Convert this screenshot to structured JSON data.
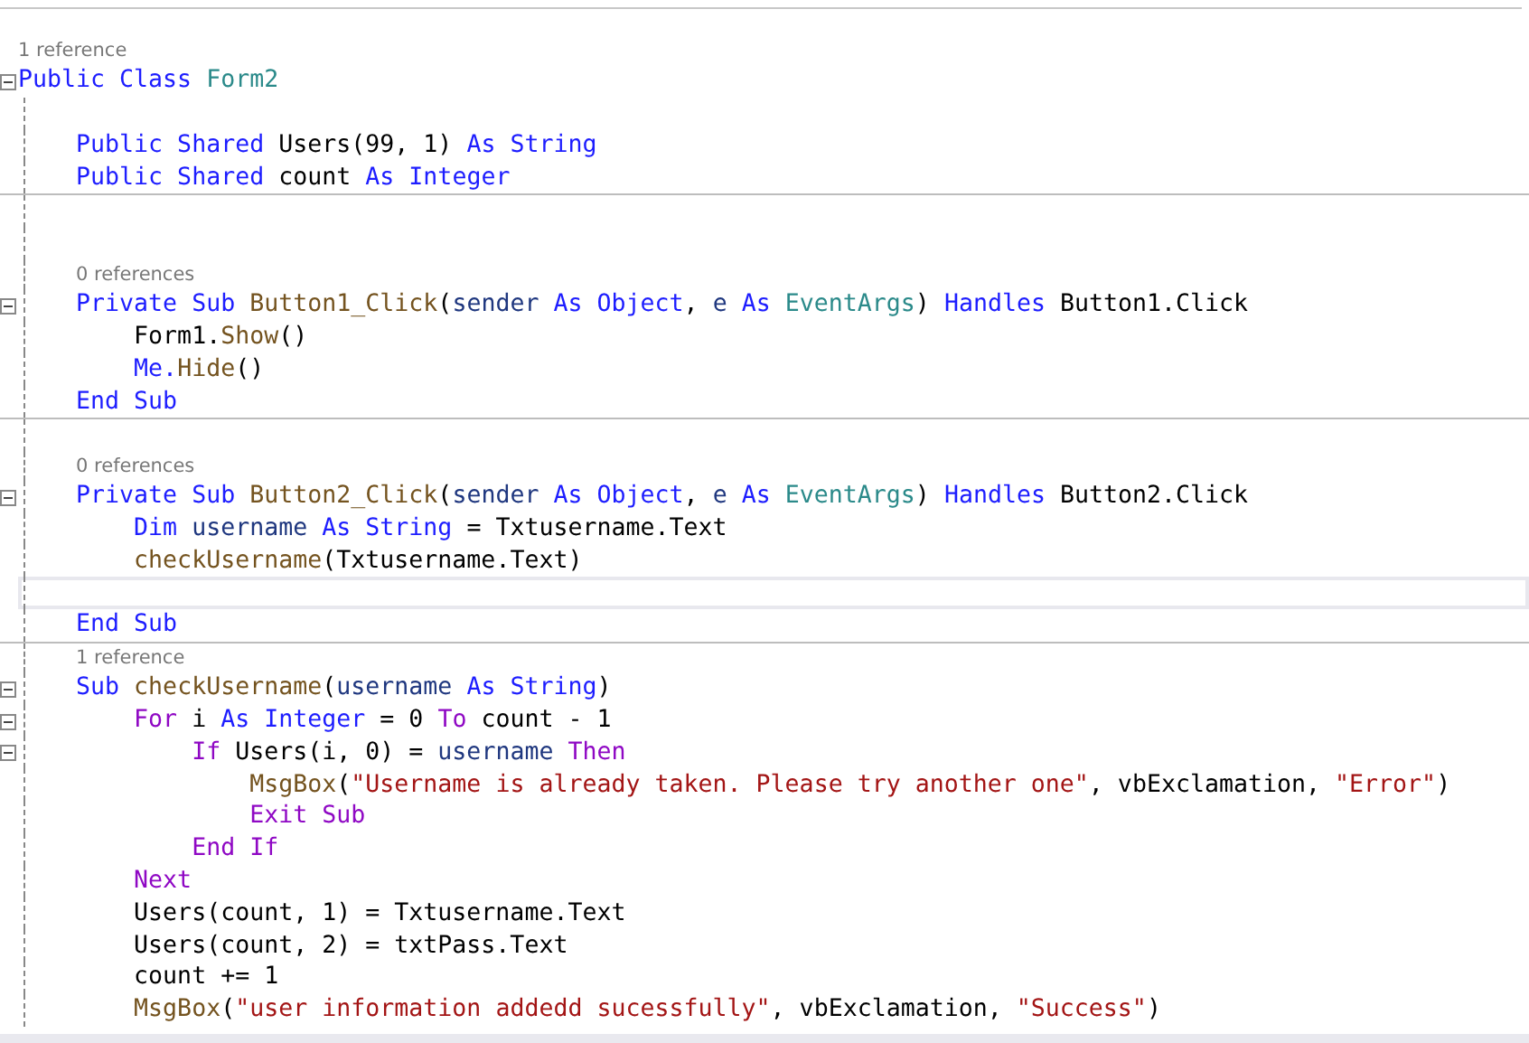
{
  "editor": {
    "lines": [
      {
        "kind": "code",
        "codelens": "1 reference",
        "expanded": true,
        "tokens": [
          {
            "text": "Public Class ",
            "kind": "kw"
          },
          {
            "text": "Form2",
            "kind": "type"
          }
        ]
      },
      {
        "kind": "blank"
      },
      {
        "kind": "code",
        "tokens": [
          {
            "text": "    Public Shared ",
            "kind": "kw"
          },
          {
            "text": "Users(99, 1) ",
            "kind": "plain"
          },
          {
            "text": "As String",
            "kind": "kw"
          }
        ]
      },
      {
        "kind": "code",
        "divider": true,
        "tokens": [
          {
            "text": "    Public Shared ",
            "kind": "kw"
          },
          {
            "text": "count ",
            "kind": "plain"
          },
          {
            "text": "As Integer",
            "kind": "kw"
          }
        ]
      },
      {
        "kind": "blank"
      },
      {
        "kind": "blank"
      },
      {
        "kind": "code",
        "codelens": "0 references",
        "expanded": true,
        "tokens": [
          {
            "text": "    Private Sub ",
            "kind": "kw"
          },
          {
            "text": "Button1_Click",
            "kind": "method"
          },
          {
            "text": "(",
            "kind": "plain"
          },
          {
            "text": "sender",
            "kind": "param"
          },
          {
            "text": " As Object",
            "kind": "kw"
          },
          {
            "text": ", ",
            "kind": "plain"
          },
          {
            "text": "e",
            "kind": "param"
          },
          {
            "text": " As ",
            "kind": "kw"
          },
          {
            "text": "EventArgs",
            "kind": "type"
          },
          {
            "text": ") ",
            "kind": "plain"
          },
          {
            "text": "Handles ",
            "kind": "kw"
          },
          {
            "text": "Button1.Click",
            "kind": "plain"
          }
        ]
      },
      {
        "kind": "code",
        "tokens": [
          {
            "text": "        Form1.",
            "kind": "plain"
          },
          {
            "text": "Show",
            "kind": "method"
          },
          {
            "text": "()",
            "kind": "plain"
          }
        ]
      },
      {
        "kind": "code",
        "tokens": [
          {
            "text": "        Me.",
            "kind": "kw"
          },
          {
            "text": "Hide",
            "kind": "method"
          },
          {
            "text": "()",
            "kind": "plain"
          }
        ]
      },
      {
        "kind": "code",
        "divider": true,
        "tokens": [
          {
            "text": "    End Sub",
            "kind": "kw"
          }
        ]
      },
      {
        "kind": "blank"
      },
      {
        "kind": "code",
        "codelens": "0 references",
        "expanded": true,
        "tokens": [
          {
            "text": "    Private Sub ",
            "kind": "kw"
          },
          {
            "text": "Button2_Click",
            "kind": "method"
          },
          {
            "text": "(",
            "kind": "plain"
          },
          {
            "text": "sender",
            "kind": "param"
          },
          {
            "text": " As Object",
            "kind": "kw"
          },
          {
            "text": ", ",
            "kind": "plain"
          },
          {
            "text": "e",
            "kind": "param"
          },
          {
            "text": " As ",
            "kind": "kw"
          },
          {
            "text": "EventArgs",
            "kind": "type"
          },
          {
            "text": ") ",
            "kind": "plain"
          },
          {
            "text": "Handles ",
            "kind": "kw"
          },
          {
            "text": "Button2.Click",
            "kind": "plain"
          }
        ]
      },
      {
        "kind": "code",
        "tokens": [
          {
            "text": "        Dim ",
            "kind": "kw"
          },
          {
            "text": "username",
            "kind": "param"
          },
          {
            "text": " As String",
            "kind": "kw"
          },
          {
            "text": " = Txtusername.Text",
            "kind": "plain"
          }
        ]
      },
      {
        "kind": "code",
        "tokens": [
          {
            "text": "        checkUsername",
            "kind": "method"
          },
          {
            "text": "(Txtusername.Text)",
            "kind": "plain"
          }
        ]
      },
      {
        "kind": "blank",
        "current": true
      },
      {
        "kind": "code",
        "divider": true,
        "tokens": [
          {
            "text": "    End Sub",
            "kind": "kw"
          }
        ]
      },
      {
        "kind": "code",
        "codelens": "1 reference",
        "expanded": true,
        "tokens": [
          {
            "text": "    Sub ",
            "kind": "kw"
          },
          {
            "text": "checkUsername",
            "kind": "method"
          },
          {
            "text": "(",
            "kind": "plain"
          },
          {
            "text": "username",
            "kind": "param"
          },
          {
            "text": " As String",
            "kind": "kw"
          },
          {
            "text": ")",
            "kind": "plain"
          }
        ]
      },
      {
        "kind": "code",
        "expanded": true,
        "tokens": [
          {
            "text": "        For ",
            "kind": "ctrl"
          },
          {
            "text": "i ",
            "kind": "plain"
          },
          {
            "text": "As Integer",
            "kind": "kw"
          },
          {
            "text": " = 0 ",
            "kind": "plain"
          },
          {
            "text": "To ",
            "kind": "ctrl"
          },
          {
            "text": "count - 1",
            "kind": "plain"
          }
        ]
      },
      {
        "kind": "code",
        "expanded": true,
        "tokens": [
          {
            "text": "            If ",
            "kind": "ctrl"
          },
          {
            "text": "Users(i, 0) = ",
            "kind": "plain"
          },
          {
            "text": "username",
            "kind": "param"
          },
          {
            "text": " Then",
            "kind": "ctrl"
          }
        ]
      },
      {
        "kind": "code",
        "tokens": [
          {
            "text": "                MsgBox",
            "kind": "method"
          },
          {
            "text": "(",
            "kind": "plain"
          },
          {
            "text": "\"Username is already taken. Please try another one\"",
            "kind": "str"
          },
          {
            "text": ", vbExclamation, ",
            "kind": "plain"
          },
          {
            "text": "\"Error\"",
            "kind": "str"
          },
          {
            "text": ")",
            "kind": "plain"
          }
        ]
      },
      {
        "kind": "code",
        "tokens": [
          {
            "text": "                Exit Sub",
            "kind": "ctrl"
          }
        ]
      },
      {
        "kind": "code",
        "tokens": [
          {
            "text": "            End If",
            "kind": "ctrl"
          }
        ]
      },
      {
        "kind": "code",
        "tokens": [
          {
            "text": "        Next",
            "kind": "ctrl"
          }
        ]
      },
      {
        "kind": "code",
        "tokens": [
          {
            "text": "        Users(count, 1) = Txtusername.Text",
            "kind": "plain"
          }
        ]
      },
      {
        "kind": "code",
        "tokens": [
          {
            "text": "        Users(count, 2) = txtPass.Text",
            "kind": "plain"
          }
        ]
      },
      {
        "kind": "code",
        "tokens": [
          {
            "text": "        count += 1",
            "kind": "plain"
          }
        ]
      },
      {
        "kind": "code",
        "tokens": [
          {
            "text": "        MsgBox",
            "kind": "method"
          },
          {
            "text": "(",
            "kind": "plain"
          },
          {
            "text": "\"user information addedd sucessfully\"",
            "kind": "str"
          },
          {
            "text": ", vbExclamation, ",
            "kind": "plain"
          },
          {
            "text": "\"Success\"",
            "kind": "str"
          },
          {
            "text": ")",
            "kind": "plain"
          }
        ]
      }
    ]
  }
}
